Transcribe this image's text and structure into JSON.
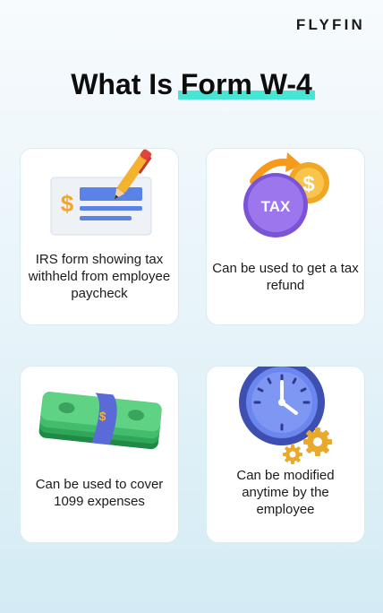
{
  "brand": {
    "logo_text": "FLYFIN"
  },
  "headline": {
    "prefix": "What Is ",
    "highlight": "Form W-4"
  },
  "cards": [
    {
      "caption": "IRS form showing tax withheld from employee paycheck",
      "icon": "form-with-pen-icon"
    },
    {
      "caption": "Can be used to get a tax refund",
      "icon": "tax-coin-refund-icon"
    },
    {
      "caption": "Can be used to cover 1099 expenses",
      "icon": "cash-stack-icon"
    },
    {
      "caption": "Can be modified anytime by the employee",
      "icon": "clock-gears-icon"
    }
  ],
  "colors": {
    "highlight": "#45e6d6",
    "background_top": "#f7fbfd",
    "background_bottom": "#d3ebf4",
    "card": "#ffffff"
  }
}
